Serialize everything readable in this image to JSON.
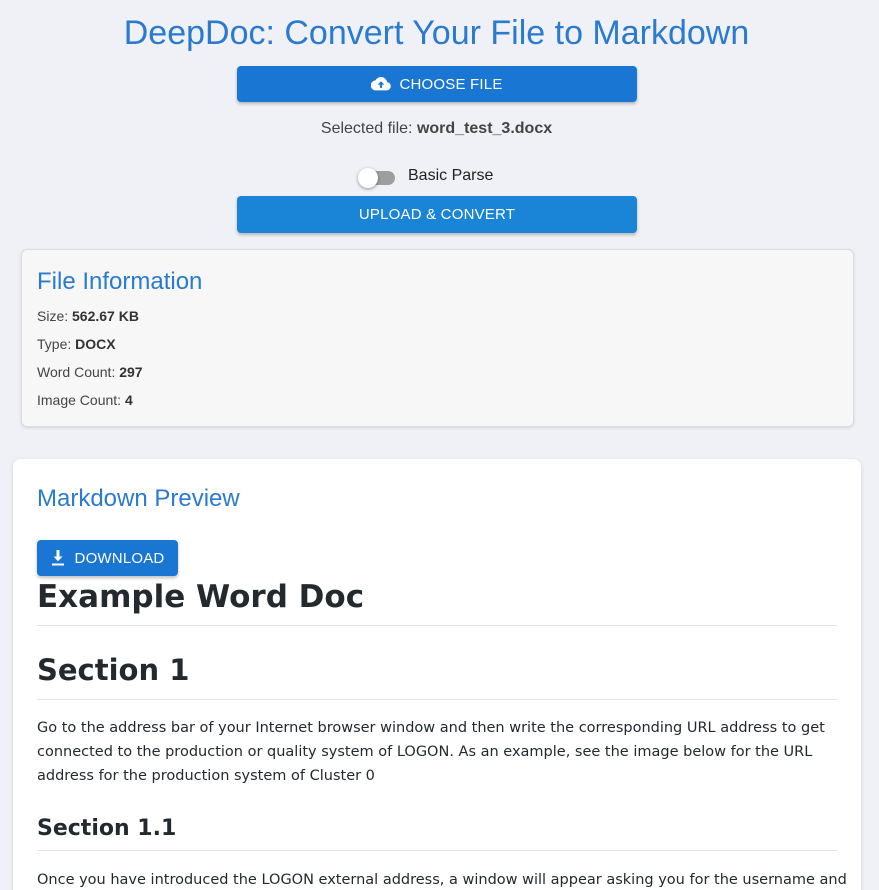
{
  "header": {
    "title": "DeepDoc: Convert Your File to Markdown"
  },
  "choose_button": {
    "label": "CHOOSE FILE",
    "icon": "cloud-upload-icon"
  },
  "selected_file": {
    "prefix": "Selected file:",
    "filename": "word_test_3.docx"
  },
  "basic_parse": {
    "label": "Basic Parse",
    "enabled": false
  },
  "upload_button": {
    "label": "UPLOAD & CONVERT"
  },
  "file_info": {
    "title": "File Information",
    "size_label": "Size:",
    "size_value": "562.67 KB",
    "type_label": "Type:",
    "type_value": "DOCX",
    "word_count_label": "Word Count:",
    "word_count_value": "297",
    "image_count_label": "Image Count:",
    "image_count_value": "4"
  },
  "preview": {
    "title": "Markdown Preview",
    "download_label": "DOWNLOAD",
    "download_icon": "download-icon",
    "h1": "Example Word Doc",
    "h2": "Section 1",
    "p1": "Go to the address bar of your Internet browser window and then write the corresponding URL address to get connected to the production or quality system of LOGON. As an example, see the image below for the URL address for the production system of Cluster 0",
    "h3": "Section 1.1",
    "p2": "Once you have introduced the LOGON external address, a window will appear asking you for the username and"
  },
  "colors": {
    "accent": "#2a7bd0",
    "primary_button": "#1976d2",
    "upload_button": "#1a85d6",
    "background": "#f0f1f6"
  }
}
